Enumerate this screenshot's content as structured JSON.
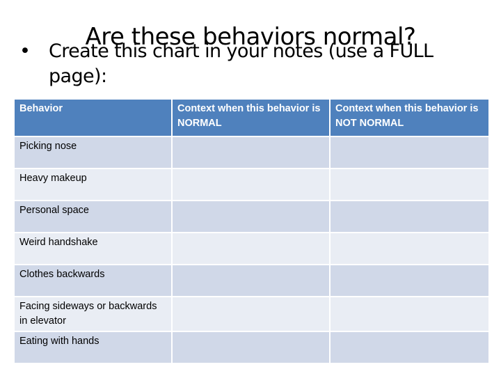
{
  "slide": {
    "title": "Are these behaviors normal?",
    "bullet_symbol": "•",
    "bullet_text": "Create this chart in your notes (use a FULL page):"
  },
  "table": {
    "headers": [
      "Behavior",
      "Context when this behavior is NORMAL",
      "Context when this behavior is NOT NORMAL"
    ],
    "rows": [
      {
        "behavior": "Picking nose",
        "normal": "",
        "not_normal": ""
      },
      {
        "behavior": "Heavy makeup",
        "normal": "",
        "not_normal": ""
      },
      {
        "behavior": "Personal space",
        "normal": "",
        "not_normal": ""
      },
      {
        "behavior": "Weird handshake",
        "normal": "",
        "not_normal": ""
      },
      {
        "behavior": "Clothes backwards",
        "normal": "",
        "not_normal": ""
      },
      {
        "behavior": "Facing sideways or backwards in elevator",
        "normal": "",
        "not_normal": ""
      },
      {
        "behavior": "Eating with hands",
        "normal": "",
        "not_normal": ""
      }
    ],
    "colors": {
      "header_bg": "#4F81BD",
      "header_text": "#FFFFFF",
      "row_odd_bg": "#D0D8E8",
      "row_even_bg": "#E9EDF4"
    }
  }
}
